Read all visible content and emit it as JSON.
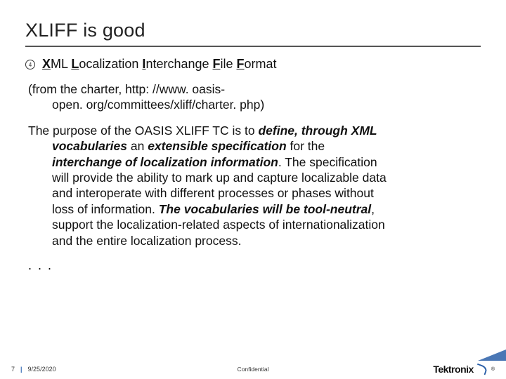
{
  "title": "XLIFF is good",
  "acronym": {
    "x": "X",
    "ml": "ML ",
    "l": "L",
    "ocalization": "ocalization ",
    "i": "I",
    "nterchange": "nterchange ",
    "f1": "F",
    "ile": "ile ",
    "f2": "F",
    "ormat": "ormat"
  },
  "charter": {
    "line1": "(from the charter, http: //www. oasis-",
    "line2": "open. org/committees/xliff/charter. php)"
  },
  "purpose": {
    "lead": "The purpose of the OASIS XLIFF TC is to ",
    "bi1": "define, through XML",
    "bi2": "vocabularies",
    "mid1": " an ",
    "bi3": "extensible specification",
    "mid2": " for the",
    "bi4": "interchange of localization information",
    "tail1": ". The specification",
    "line4": "will provide the ability to mark up and capture localizable data",
    "line5": "and interoperate with different processes or phases without",
    "line6a": "loss of information. ",
    "bi5": "The vocabularies will be tool-neutral",
    "line6b": ",",
    "line7": "support the localization-related aspects of internationalization",
    "line8": "and the entire localization process."
  },
  "ellipsis": ". . .",
  "footer": {
    "page": "7",
    "date": "9/25/2020",
    "confidential": "Confidential",
    "brand": "Tektronix",
    "reg": "®"
  },
  "bullet_glyph": "4"
}
